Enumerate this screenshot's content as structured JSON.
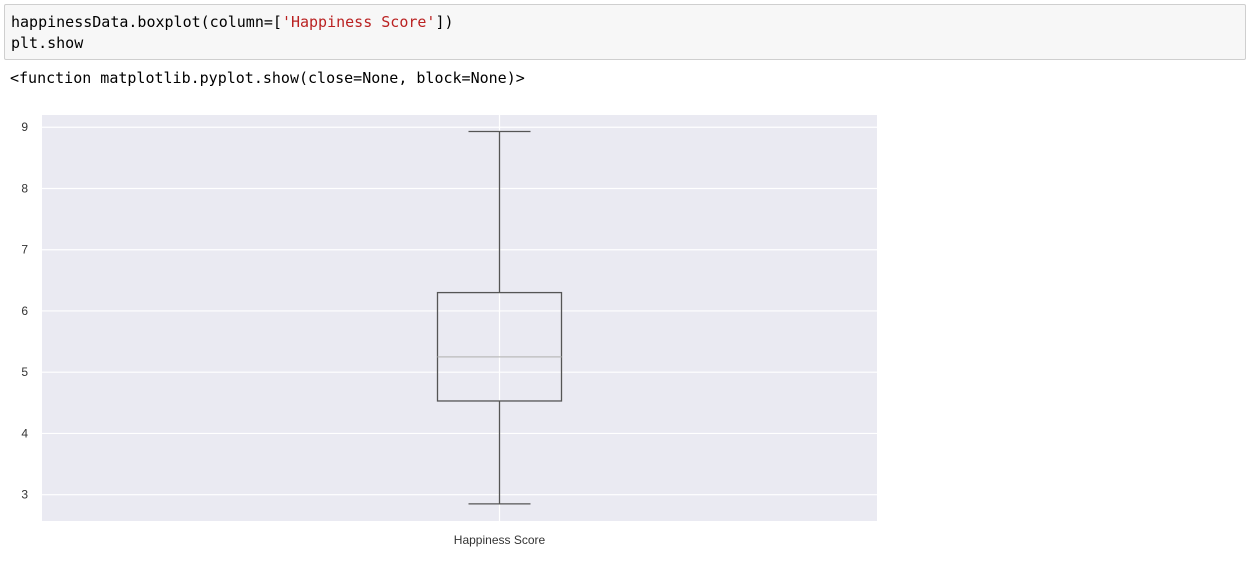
{
  "cell": {
    "code_line_1_prefix": "happinessData.boxplot(column=[",
    "code_line_1_string": "'Happiness Score'",
    "code_line_1_suffix": "])",
    "code_line_2": "plt.show"
  },
  "output": {
    "text": "<function matplotlib.pyplot.show(close=None, block=None)>"
  },
  "colors": {
    "axes_bg": "#eaeaf2",
    "grid": "#ffffff",
    "box": "#555555",
    "median": "#bbbbbb"
  },
  "chart_data": {
    "type": "box",
    "categories": [
      "Happiness Score"
    ],
    "box": {
      "whisker_low": 2.85,
      "q1": 4.53,
      "median": 5.25,
      "q3": 6.3,
      "whisker_high": 8.93
    },
    "yticks": [
      3,
      4,
      5,
      6,
      7,
      8,
      9
    ],
    "ylim": [
      2.57,
      9.2
    ],
    "grid": true
  }
}
